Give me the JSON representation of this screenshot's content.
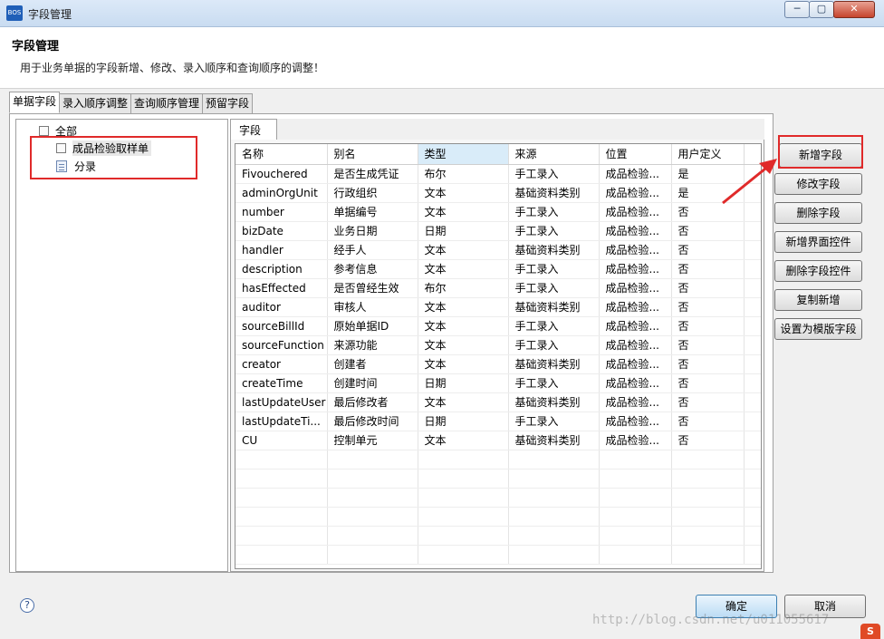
{
  "window": {
    "app_icon_text": "BOS",
    "title": "字段管理",
    "min_icon": "─",
    "max_icon": "▢",
    "close_icon": "✕"
  },
  "header": {
    "title": "字段管理",
    "description": "用于业务单据的字段新增、修改、录入顺序和查询顺序的调整！"
  },
  "tabs": [
    {
      "label": "单据字段",
      "active": true
    },
    {
      "label": "录入顺序调整",
      "active": false
    },
    {
      "label": "查询顺序管理",
      "active": false
    },
    {
      "label": "预留字段",
      "active": false
    }
  ],
  "tree": {
    "root": "全部",
    "items": [
      "成品检验取样单",
      "分录"
    ]
  },
  "field_tab": {
    "label": "字段"
  },
  "grid": {
    "columns": [
      "名称",
      "别名",
      "类型",
      "来源",
      "位置",
      "用户定义"
    ],
    "rows": [
      [
        "Fivouchered",
        "是否生成凭证",
        "布尔",
        "手工录入",
        "成品检验...",
        "是"
      ],
      [
        "adminOrgUnit",
        "行政组织",
        "文本",
        "基础资料类别",
        "成品检验...",
        "是"
      ],
      [
        "number",
        "单据编号",
        "文本",
        "手工录入",
        "成品检验...",
        "否"
      ],
      [
        "bizDate",
        "业务日期",
        "日期",
        "手工录入",
        "成品检验...",
        "否"
      ],
      [
        "handler",
        "经手人",
        "文本",
        "基础资料类别",
        "成品检验...",
        "否"
      ],
      [
        "description",
        "参考信息",
        "文本",
        "手工录入",
        "成品检验...",
        "否"
      ],
      [
        "hasEffected",
        "是否曾经生效",
        "布尔",
        "手工录入",
        "成品检验...",
        "否"
      ],
      [
        "auditor",
        "审核人",
        "文本",
        "基础资料类别",
        "成品检验...",
        "否"
      ],
      [
        "sourceBillId",
        "原始单据ID",
        "文本",
        "手工录入",
        "成品检验...",
        "否"
      ],
      [
        "sourceFunction",
        "来源功能",
        "文本",
        "手工录入",
        "成品检验...",
        "否"
      ],
      [
        "creator",
        "创建者",
        "文本",
        "基础资料类别",
        "成品检验...",
        "否"
      ],
      [
        "createTime",
        "创建时间",
        "日期",
        "手工录入",
        "成品检验...",
        "否"
      ],
      [
        "lastUpdateUser",
        "最后修改者",
        "文本",
        "基础资料类别",
        "成品检验...",
        "否"
      ],
      [
        "lastUpdateTi...",
        "最后修改时间",
        "日期",
        "手工录入",
        "成品检验...",
        "否"
      ],
      [
        "CU",
        "控制单元",
        "文本",
        "基础资料类别",
        "成品检验...",
        "否"
      ]
    ],
    "empty_rows": 6
  },
  "buttons": {
    "add_field": "新增字段",
    "edit_field": "修改字段",
    "delete_field": "删除字段",
    "add_ui_control": "新增界面控件",
    "delete_field_control": "删除字段控件",
    "copy_add": "复制新增",
    "set_template": "设置为模版字段"
  },
  "footer": {
    "help_icon": "?",
    "ok": "确定",
    "cancel": "取消"
  },
  "watermark": {
    "text": "http://blog.csdn.net/u011055617",
    "logo": "S"
  },
  "colors": {
    "annotation_red": "#e02a2a",
    "sorted_header": "#d9ecf9"
  }
}
